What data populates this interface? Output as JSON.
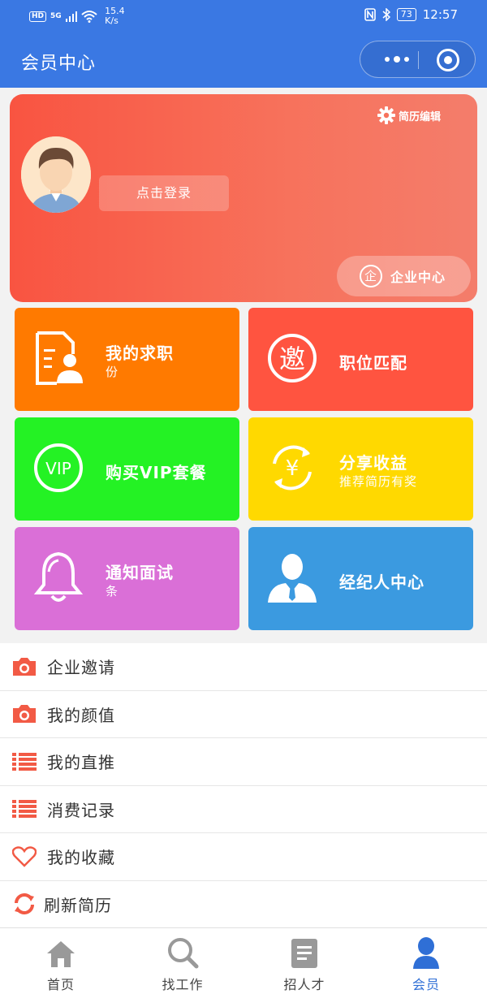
{
  "status_bar": {
    "hd": "HD",
    "network": "5G",
    "speed_value": "15.4",
    "speed_unit": "K/s",
    "battery": "73",
    "time": "12:57"
  },
  "header": {
    "title": "会员中心"
  },
  "profile": {
    "login_label": "点击登录",
    "resume_edit_label": "简历编辑",
    "corp_center_label": "企业中心",
    "corp_icon_char": "企"
  },
  "tiles": [
    {
      "title": "我的求职",
      "subtitle": "份",
      "icon": "resume-person-icon",
      "color": "#ff7a00"
    },
    {
      "title": "职位匹配",
      "subtitle": "",
      "icon": "invite-seal-icon",
      "icon_char": "邀",
      "color": "#ff5440"
    },
    {
      "title": "购买VIP套餐",
      "subtitle": "",
      "icon": "vip-badge-icon",
      "icon_char": "VIP",
      "color": "#24f224"
    },
    {
      "title": "分享收益",
      "subtitle": "推荐简历有奖",
      "icon": "yen-cycle-icon",
      "icon_char": "¥",
      "color": "#ffd900"
    },
    {
      "title": "通知面试",
      "subtitle": "条",
      "icon": "bell-icon",
      "color": "#da6fd7"
    },
    {
      "title": "经纪人中心",
      "subtitle": "",
      "icon": "agent-person-icon",
      "color": "#3b9ae0"
    }
  ],
  "menu": [
    {
      "label": "企业邀请",
      "icon": "camera-icon"
    },
    {
      "label": "我的颜值",
      "icon": "camera-icon"
    },
    {
      "label": "我的直推",
      "icon": "list-icon"
    },
    {
      "label": "消费记录",
      "icon": "list-icon"
    },
    {
      "label": "我的收藏",
      "icon": "heart-icon"
    },
    {
      "label": "刷新简历",
      "icon": "refresh-icon"
    }
  ],
  "tabbar": [
    {
      "label": "首页",
      "icon": "home-icon",
      "active": false
    },
    {
      "label": "找工作",
      "icon": "search-icon",
      "active": false
    },
    {
      "label": "招人才",
      "icon": "document-icon",
      "active": false
    },
    {
      "label": "会员",
      "icon": "user-icon",
      "active": true
    }
  ],
  "colors": {
    "primary": "#3a78e3",
    "menu_icon": "#f25a45",
    "tab_active": "#2f6fd6"
  }
}
